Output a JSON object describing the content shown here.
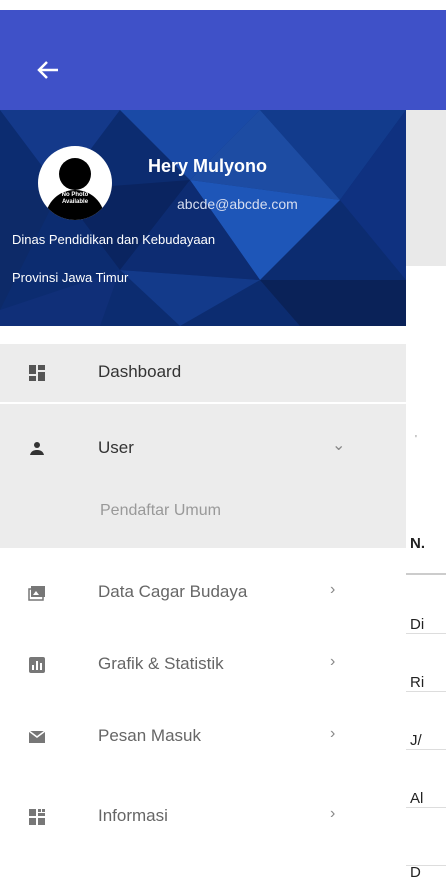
{
  "header": {
    "back_icon": "arrow-left-icon",
    "background": "#3f51c8"
  },
  "profile": {
    "name": "Hery Mulyono",
    "email": "abcde@abcde.com",
    "org_line1": "Dinas Pendidikan dan Kebudayaan",
    "org_line2": "Provinsi Jawa Timur",
    "avatar_text_line1": "No Photo",
    "avatar_text_line2": "Available"
  },
  "sidebar": {
    "items": [
      {
        "label": "Dashboard",
        "icon": "dashboard-icon"
      },
      {
        "label": "User",
        "icon": "person-icon",
        "expanded": true,
        "arrow": "⌄"
      },
      {
        "label": "Data Cagar Budaya",
        "icon": "photo-library-icon",
        "arrow": "›"
      },
      {
        "label": "Grafik & Statistik",
        "icon": "bar-chart-icon",
        "arrow": "›"
      },
      {
        "label": "Pesan Masuk",
        "icon": "mail-icon",
        "arrow": "›"
      },
      {
        "label": "Informasi",
        "icon": "info-grid-icon",
        "arrow": "›"
      }
    ],
    "subitems": [
      {
        "label": "Pendaftar Umum"
      }
    ]
  },
  "table": {
    "header": "N.",
    "rows": [
      "Di",
      "Ri",
      "J/",
      "Al",
      "D"
    ]
  },
  "colors": {
    "accent": "#3f51c8",
    "active_bg": "#ececec"
  }
}
